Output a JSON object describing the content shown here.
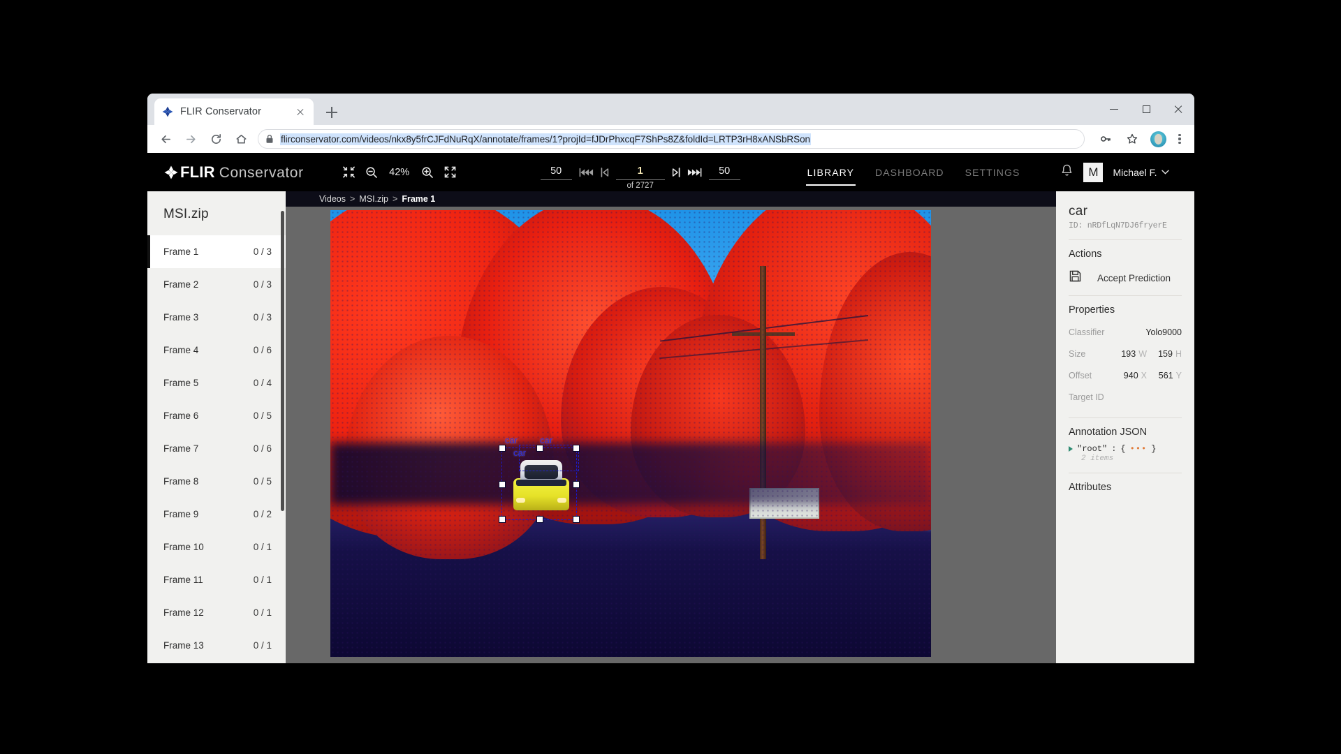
{
  "browser": {
    "tab": {
      "title": "FLIR Conservator",
      "favicon": "flir-diamond-icon"
    },
    "newtab_label": "+",
    "url": "flirconservator.com/videos/nkx8y5frCJFdNuRqX/annotate/frames/1?projId=fJDrPhxcqF7ShPs8Z&foldId=LRTP3rH8xANSbRSon",
    "icons": {
      "back": "back-arrow-icon",
      "forward": "forward-arrow-icon",
      "reload": "reload-icon",
      "home": "home-icon",
      "lock": "lock-icon",
      "key": "key-icon",
      "bookmark": "star-icon",
      "profile": "profile-avatar-icon",
      "menu": "three-dot-menu-icon"
    },
    "window": {
      "minimize": "minimize-icon",
      "maximize": "maximize-icon",
      "close": "close-icon"
    }
  },
  "appbar": {
    "brand_flir": "FLIR",
    "brand_rest": "Conservator",
    "zoom": {
      "fit_icon": "fit-to-screen-icon",
      "out_icon": "zoom-out-icon",
      "level": "42%",
      "in_icon": "zoom-in-icon",
      "expand_icon": "fullscreen-icon"
    },
    "frames": {
      "step_back": "50",
      "jump_back_icon": "skip-back-fast-icon",
      "prev_icon": "step-back-icon",
      "current": "1",
      "total_label": "of 2727",
      "next_icon": "step-forward-icon",
      "jump_fwd_icon": "skip-forward-fast-icon",
      "step_fwd": "50"
    },
    "nav": [
      {
        "label": "LIBRARY",
        "active": true
      },
      {
        "label": "DASHBOARD",
        "active": false
      },
      {
        "label": "SETTINGS",
        "active": false
      }
    ],
    "bell_icon": "notification-bell-icon",
    "avatar_initial": "M",
    "user_name": "Michael F.",
    "user_chevron": "chevron-down-icon"
  },
  "sidebar": {
    "title": "MSI.zip",
    "items": [
      {
        "label": "Frame 1",
        "count": "0 / 3",
        "selected": true
      },
      {
        "label": "Frame 2",
        "count": "0 / 3",
        "selected": false
      },
      {
        "label": "Frame 3",
        "count": "0 / 3",
        "selected": false
      },
      {
        "label": "Frame 4",
        "count": "0 / 6",
        "selected": false
      },
      {
        "label": "Frame 5",
        "count": "0 / 4",
        "selected": false
      },
      {
        "label": "Frame 6",
        "count": "0 / 5",
        "selected": false
      },
      {
        "label": "Frame 7",
        "count": "0 / 6",
        "selected": false
      },
      {
        "label": "Frame 8",
        "count": "0 / 5",
        "selected": false
      },
      {
        "label": "Frame 9",
        "count": "0 / 2",
        "selected": false
      },
      {
        "label": "Frame 10",
        "count": "0 / 1",
        "selected": false
      },
      {
        "label": "Frame 11",
        "count": "0 / 1",
        "selected": false
      },
      {
        "label": "Frame 12",
        "count": "0 / 1",
        "selected": false
      },
      {
        "label": "Frame 13",
        "count": "0 / 1",
        "selected": false
      }
    ]
  },
  "breadcrumb": {
    "root": "Videos",
    "sep": ">",
    "folder": "MSI.zip",
    "current": "Frame 1"
  },
  "viewer": {
    "annotations": [
      {
        "label": "car"
      },
      {
        "label": "car"
      },
      {
        "label": "car"
      }
    ]
  },
  "inspector": {
    "title": "car",
    "id": "ID: nRDfLqN7DJ6fryerE",
    "actions_heading": "Actions",
    "accept_icon": "save-floppy-icon",
    "accept_label": "Accept Prediction",
    "properties_heading": "Properties",
    "properties": {
      "classifier_key": "Classifier",
      "classifier_value": "Yolo9000",
      "size_key": "Size",
      "size_w": "193",
      "size_w_unit": "W",
      "size_h": "159",
      "size_h_unit": "H",
      "offset_key": "Offset",
      "offset_x": "940",
      "offset_x_unit": "X",
      "offset_y": "561",
      "offset_y_unit": "Y",
      "target_id_key": "Target ID"
    },
    "json_heading": "Annotation JSON",
    "json_key": "\"root\"",
    "json_colon": ":",
    "json_open": "{",
    "json_dots": "•••",
    "json_close": "}",
    "json_items": "2 items",
    "attributes_heading": "Attributes"
  },
  "colors": {
    "accent_dark": "#000000",
    "panel_bg": "#f1f1ef",
    "canvas_bg": "#686868",
    "annotation": "#2a2ae0",
    "highlight_url": "#cfe3fc"
  }
}
